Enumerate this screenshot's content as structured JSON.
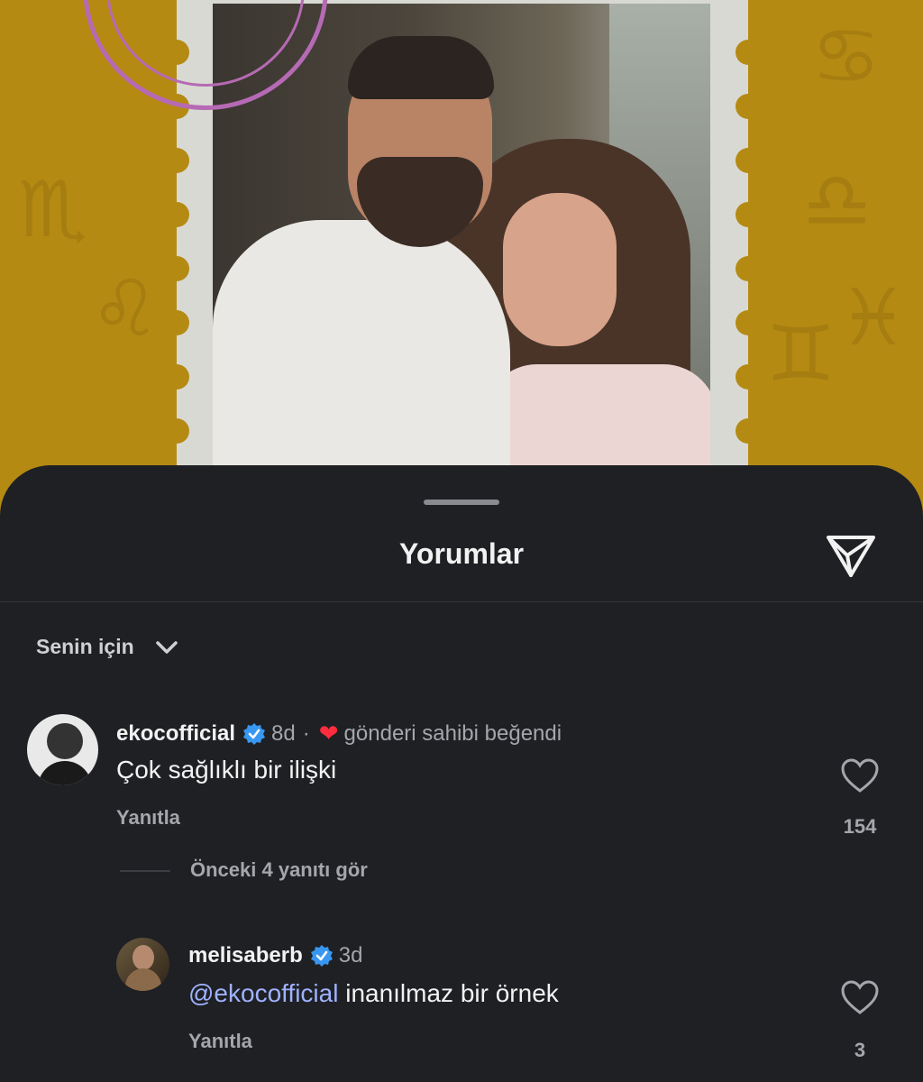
{
  "sheet": {
    "title": "Yorumlar",
    "sort_label": "Senin için"
  },
  "comments": [
    {
      "username": "ekocofficial",
      "verified": true,
      "time": "8d",
      "separator": "·",
      "liked_by_author_label": "gönderi sahibi beğendi",
      "text": "Çok sağlıklı bir ilişki",
      "reply_label": "Yanıtla",
      "like_count": "154"
    }
  ],
  "thread": {
    "view_previous_label": "Önceki 4 yanıtı gör"
  },
  "replies": [
    {
      "username": "melisaberb",
      "verified": true,
      "time": "3d",
      "mention": "@ekocofficial",
      "text": "inanılmaz bir örnek",
      "reply_label": "Yanıtla",
      "like_count": "3"
    }
  ],
  "colors": {
    "sheet_bg": "#1f2024",
    "post_bg": "#b48a12",
    "verified_blue": "#3897f0",
    "mention_blue": "#9fb2ff",
    "heart_red": "#ff2d3d"
  },
  "icons": {
    "share": "paper-plane-icon",
    "sort": "chevron-down-icon",
    "like": "heart-outline-icon",
    "verified": "verified-badge-icon"
  }
}
